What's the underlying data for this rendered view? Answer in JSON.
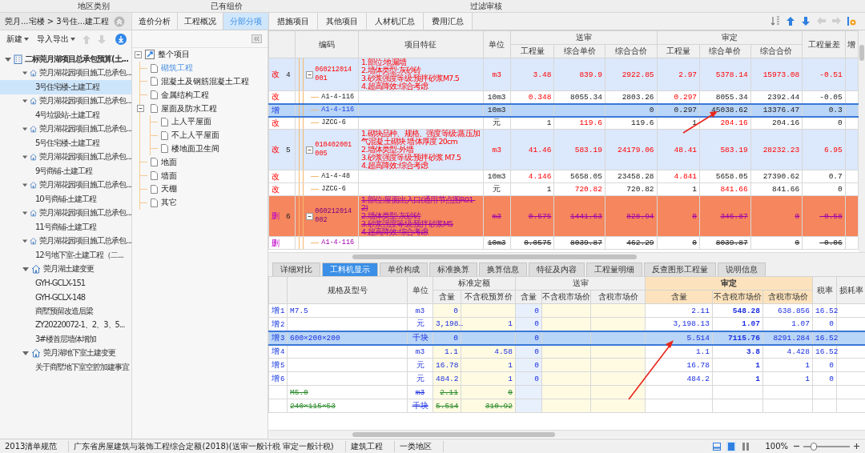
{
  "toolbar": {
    "labels": [
      "地区类别",
      "已有组价",
      "过滤审核"
    ]
  },
  "project_panel": {
    "breadcrumb": "莞月...宅楼 > 3号住...建工程",
    "buttons": [
      {
        "label": "新建",
        "kind": "dropdown"
      },
      {
        "label": "导入导出",
        "kind": "dropdown"
      }
    ],
    "move_buttons": [
      {
        "kind": "up",
        "disabled": true
      },
      {
        "kind": "down",
        "disabled": true
      }
    ],
    "tree": [
      {
        "label": "二标莞月湖项目总承包预算(土...",
        "kind": "project",
        "expanded": true,
        "selected": false,
        "children": [
          {
            "label": "莞月湖花园项目施工总承包...",
            "kind": "group",
            "expanded": true,
            "selected": false,
            "children": [
              {
                "label": "3号住宅楼-土建工程",
                "selected": true
              }
            ]
          },
          {
            "label": "莞月湖花园项目施工总承包...",
            "kind": "group",
            "expanded": true,
            "selected": false,
            "children": [
              {
                "label": "4号垃圾站-土建工程",
                "selected": false
              }
            ]
          },
          {
            "label": "莞月湖花园项目施工总承包...",
            "kind": "group",
            "expanded": true,
            "selected": false,
            "children": [
              {
                "label": "5号住宅楼-土建工程",
                "selected": false
              }
            ]
          },
          {
            "label": "莞月湖花园项目施工总承包...",
            "kind": "group",
            "expanded": true,
            "selected": false,
            "children": [
              {
                "label": "9号商铺-土建工程",
                "selected": false
              }
            ]
          },
          {
            "label": "莞月湖花园项目施工总承包...",
            "kind": "group",
            "expanded": true,
            "selected": false,
            "children": [
              {
                "label": "10号商铺-土建工程",
                "selected": false
              }
            ]
          },
          {
            "label": "莞月湖花园项目施工总承包...",
            "kind": "group",
            "expanded": true,
            "selected": false,
            "children": [
              {
                "label": "11号商铺-土建工程",
                "selected": false
              }
            ]
          },
          {
            "label": "莞月湖花园项目施工总承包...",
            "kind": "group",
            "expanded": true,
            "selected": false,
            "children": [
              {
                "label": "12号地下室-土建工程（二...",
                "selected": false
              }
            ]
          },
          {
            "label": "莞月湖土建变更",
            "kind": "group",
            "expanded": true,
            "selected": false,
            "children": [
              {
                "label": "GYH-GCLX-151",
                "selected": false
              },
              {
                "label": "GYH-GCLX-148",
                "selected": false
              },
              {
                "label": "商墅预留改造后梁",
                "selected": false
              },
              {
                "label": "ZY20220072-1、2、3、5...",
                "selected": false
              },
              {
                "label": "3#楼首层墙体增加",
                "selected": false
              }
            ]
          },
          {
            "label": "莞月湖地下室土建变更",
            "kind": "group",
            "expanded": true,
            "selected": false,
            "children": [
              {
                "label": "关于商墅地下室空腔加建事宜",
                "selected": false
              }
            ]
          }
        ]
      }
    ]
  },
  "view_tabs": [
    {
      "label": "造价分析",
      "selected": false
    },
    {
      "label": "工程概况",
      "selected": false
    },
    {
      "label": "分部分项",
      "selected": true
    },
    {
      "label": "措施项目",
      "selected": false
    },
    {
      "label": "其他项目",
      "selected": false
    },
    {
      "label": "人材机汇总",
      "selected": false
    },
    {
      "label": "费用汇总",
      "selected": false
    }
  ],
  "toolbar_icons": [
    {
      "kind": "sort",
      "disabled": false
    },
    {
      "kind": "up",
      "disabled": false
    },
    {
      "kind": "down",
      "disabled": false
    },
    {
      "kind": "left",
      "disabled": true
    },
    {
      "kind": "right",
      "disabled": true
    },
    {
      "kind": "settings",
      "disabled": false
    }
  ],
  "section_tree": [
    {
      "label": "整个项目",
      "kind": "root",
      "expanded": true,
      "selected": false,
      "children": [
        {
          "label": "砌筑工程",
          "selected": true
        },
        {
          "label": "混凝土及钢筋混凝土工程",
          "selected": false
        },
        {
          "label": "金属结构工程",
          "selected": false
        },
        {
          "label": "屋面及防水工程",
          "selected": false,
          "expanded": true,
          "children": [
            {
              "label": "上人平屋面",
              "selected": false
            },
            {
              "label": "不上人平屋面",
              "selected": false
            },
            {
              "label": "楼地面卫生间",
              "selected": false
            }
          ]
        },
        {
          "label": "地面",
          "selected": false
        },
        {
          "label": "墙面",
          "selected": false
        },
        {
          "label": "天棚",
          "selected": false
        },
        {
          "label": "其它",
          "selected": false
        }
      ]
    }
  ],
  "bill_table": {
    "columns": [
      "编码",
      "项目特征",
      "单位"
    ],
    "groups": [
      {
        "label": "送审",
        "highlighted": false,
        "columns": [
          "工程量",
          "综合单价",
          "综合合价"
        ]
      },
      {
        "label": "审定",
        "highlighted": false,
        "columns": [
          "工程量",
          "综合单价",
          "综合合价"
        ]
      }
    ],
    "trailing_columns": [
      "工程量差",
      "增"
    ],
    "rows": [
      {
        "kind": "changed",
        "expanded": true,
        "flag": "改",
        "index": "4",
        "code": "060212014001",
        "features": [
          "1.部位:地漏墙",
          "2.墙体类型:灰砂砖",
          "3.砂浆强度等级:预拌砂浆M7.5",
          "4.超高降效:综合考虑"
        ],
        "unit": "m3",
        "selected": false,
        "cells": {
          "submit_qty": {
            "text": "3.48",
            "changed": true
          },
          "submit_price": {
            "text": "839.9",
            "changed": true
          },
          "submit_total": {
            "text": "2922.85",
            "changed": true
          },
          "approved_qty": {
            "text": "2.97",
            "changed": true
          },
          "approved_price": {
            "text": "5378.14",
            "changed": true
          },
          "approved_total": {
            "text": "15973.08",
            "changed": true
          },
          "qty_diff": {
            "text": "-0.51",
            "changed": true
          }
        }
      },
      {
        "kind": "changed",
        "flag": "改",
        "code": "A1-4-116",
        "unit": "10m3",
        "selected": false,
        "cells": {
          "submit_qty": {
            "text": "0.348",
            "changed": true
          },
          "submit_price": {
            "text": "8055.34",
            "changed": false
          },
          "submit_total": {
            "text": "2803.26",
            "changed": false
          },
          "approved_qty": {
            "text": "0.297",
            "changed": true
          },
          "approved_price": {
            "text": "8055.34",
            "changed": false
          },
          "approved_total": {
            "text": "2392.44",
            "changed": false
          },
          "qty_diff": {
            "text": "-0.05",
            "changed": false
          }
        }
      },
      {
        "kind": "added",
        "flag": "增",
        "code": "A1-4-116",
        "unit": "10m3",
        "selected": true,
        "cells": {
          "submit_total": {
            "text": "0",
            "changed": false
          },
          "approved_qty": {
            "text": "0.297",
            "changed": false
          },
          "approved_price": {
            "text": "45038.62",
            "changed": false
          },
          "approved_total": {
            "text": "13376.47",
            "changed": false
          },
          "qty_diff": {
            "text": "0.3",
            "changed": false
          }
        }
      },
      {
        "kind": "changed",
        "flag": "改",
        "code": "JZCG-6",
        "unit": "元",
        "selected": false,
        "cells": {
          "submit_qty": {
            "text": "1",
            "changed": false
          },
          "submit_price": {
            "text": "119.6",
            "changed": true
          },
          "submit_total": {
            "text": "119.6",
            "changed": false
          },
          "approved_qty": {
            "text": "1",
            "changed": false
          },
          "approved_price": {
            "text": "204.16",
            "changed": true
          },
          "approved_total": {
            "text": "204.16",
            "changed": false
          },
          "qty_diff": {
            "text": "0",
            "changed": false
          }
        }
      },
      {
        "kind": "changed",
        "expanded": true,
        "flag": "改",
        "index": "5",
        "code": "010402001005",
        "features": [
          "1.砌块品种、规格、强度等级:蒸压加气混凝土砌块 墙体厚度 20cm",
          "2.墙体类型:外墙",
          "3.砂浆强度等级:预拌砂浆 M7.5",
          "4.超高降效:综合考虑"
        ],
        "unit": "m3",
        "selected": false,
        "cells": {
          "submit_qty": {
            "text": "41.46",
            "changed": true
          },
          "submit_price": {
            "text": "583.19",
            "changed": true
          },
          "submit_total": {
            "text": "24179.06",
            "changed": true
          },
          "approved_qty": {
            "text": "48.41",
            "changed": true
          },
          "approved_price": {
            "text": "583.19",
            "changed": true
          },
          "approved_total": {
            "text": "28232.23",
            "changed": true
          },
          "qty_diff": {
            "text": "6.95",
            "changed": true
          }
        }
      },
      {
        "kind": "changed",
        "flag": "改",
        "code": "A1-4-48",
        "unit": "10m3",
        "selected": false,
        "cells": {
          "submit_qty": {
            "text": "4.146",
            "changed": true
          },
          "submit_price": {
            "text": "5658.05",
            "changed": false
          },
          "submit_total": {
            "text": "23458.28",
            "changed": false
          },
          "approved_qty": {
            "text": "4.841",
            "changed": true
          },
          "approved_price": {
            "text": "5658.05",
            "changed": false
          },
          "approved_total": {
            "text": "27390.62",
            "changed": false
          },
          "qty_diff": {
            "text": "0.7",
            "changed": false
          }
        }
      },
      {
        "kind": "changed",
        "flag": "改",
        "code": "JZCG-6",
        "unit": "元",
        "selected": false,
        "cells": {
          "submit_qty": {
            "text": "1",
            "changed": false
          },
          "submit_price": {
            "text": "720.82",
            "changed": true
          },
          "submit_total": {
            "text": "720.82",
            "changed": false
          },
          "approved_qty": {
            "text": "1",
            "changed": false
          },
          "approved_price": {
            "text": "841.66",
            "changed": true
          },
          "approved_total": {
            "text": "841.66",
            "changed": false
          },
          "qty_diff": {
            "text": "0",
            "changed": false
          }
        }
      },
      {
        "kind": "deleted",
        "expanded": true,
        "flag": "删",
        "index": "6",
        "code": "060212014002",
        "features": [
          "1.部位:屋面出入口(通用节点图R01-2)",
          "2.墙体类型:灰砂砖",
          "3.砂浆强度等级:预拌砂浆M5",
          "4.超高降效:综合考虑"
        ],
        "unit": "m3",
        "selected": false,
        "cells": {
          "submit_qty": {
            "text": "0.575",
            "changed": false
          },
          "submit_price": {
            "text": "1441.63",
            "changed": false
          },
          "submit_total": {
            "text": "828.94",
            "changed": false
          },
          "approved_qty": {
            "text": "0",
            "changed": false
          },
          "approved_price": {
            "text": "346.87",
            "changed": false
          },
          "approved_total": {
            "text": "0",
            "changed": false
          },
          "qty_diff": {
            "text": "-0.58",
            "changed": false
          }
        }
      },
      {
        "kind": "deleted",
        "flag": "删",
        "code": "A1-4-116",
        "unit": "10m3",
        "selected": false,
        "cells": {
          "submit_qty": {
            "text": "0.0575",
            "changed": false
          },
          "submit_price": {
            "text": "8039.87",
            "changed": false
          },
          "submit_total": {
            "text": "462.29",
            "changed": false
          },
          "approved_qty": {
            "text": "0",
            "changed": false
          },
          "approved_price": {
            "text": "8039.87",
            "changed": false
          },
          "approved_total": {
            "text": "0",
            "changed": false
          },
          "qty_diff": {
            "text": "-0.06",
            "changed": false
          }
        }
      }
    ]
  },
  "detail_tabs": [
    {
      "label": "详细对比",
      "selected": false
    },
    {
      "label": "工料机显示",
      "selected": true
    },
    {
      "label": "单价构成",
      "selected": false
    },
    {
      "label": "标准换算",
      "selected": false
    },
    {
      "label": "换算信息",
      "selected": false
    },
    {
      "label": "特征及内容",
      "selected": false
    },
    {
      "label": "工程量明细",
      "selected": false
    },
    {
      "label": "反查图形工程量",
      "selected": false
    },
    {
      "label": "说明信息",
      "selected": false
    }
  ],
  "resource_table": {
    "columns": [
      "规格及型号",
      "单位"
    ],
    "groups": [
      {
        "label": "标准定额",
        "highlighted": false,
        "columns": [
          "含量",
          "不含税预算价"
        ]
      },
      {
        "label": "送审",
        "highlighted": false,
        "columns": [
          "含量",
          "不含税市场价",
          "含税市场价"
        ]
      },
      {
        "label": "审定",
        "highlighted": true,
        "columns": [
          "含量",
          "不含税市场价",
          "含税市场价"
        ]
      }
    ],
    "trailing_columns": [
      "税率",
      "损耗率"
    ],
    "rows": [
      {
        "kind": "added",
        "flag": "增",
        "index": "1",
        "spec": "M7.5",
        "unit": "m3",
        "selected": false,
        "cells": {
          "std_content": "0",
          "submit_content": "0",
          "approved_content": "2.11",
          "approved_price": "548.28",
          "approved_price_tax": "638.856",
          "tax_rate": "16.52"
        }
      },
      {
        "kind": "added",
        "flag": "增",
        "index": "2",
        "unit": "元",
        "selected": false,
        "cells": {
          "std_content": "3,198…",
          "std_price": "1",
          "submit_content": "0",
          "approved_content": "3,198.13",
          "approved_price": "1.07",
          "approved_price_tax": "1.07",
          "tax_rate": "0"
        }
      },
      {
        "kind": "added",
        "flag": "增",
        "index": "3",
        "spec": "600×200×200",
        "unit": "千块",
        "selected": true,
        "cells": {
          "std_content": "0",
          "submit_content": "0",
          "approved_content": "5.514",
          "approved_price": "7115.76",
          "approved_price_tax": "8291.284",
          "tax_rate": "16.52"
        }
      },
      {
        "kind": "added",
        "flag": "增",
        "index": "4",
        "unit": "m3",
        "selected": false,
        "cells": {
          "std_content": "1.1",
          "std_price": "4.58",
          "submit_content": "0",
          "approved_content": "1.1",
          "approved_price": "3.8",
          "approved_price_tax": "4.428",
          "tax_rate": "16.52"
        }
      },
      {
        "kind": "added",
        "flag": "增",
        "index": "5",
        "unit": "元",
        "selected": false,
        "cells": {
          "std_content": "16.78",
          "std_price": "1",
          "submit_content": "0",
          "approved_content": "16.78",
          "approved_price": "1",
          "approved_price_tax": "1",
          "tax_rate": "0"
        }
      },
      {
        "kind": "added",
        "flag": "增",
        "index": "6",
        "unit": "元",
        "selected": false,
        "cells": {
          "std_content": "484.2",
          "std_price": "1",
          "submit_content": "0",
          "approved_content": "484.2",
          "approved_price": "1",
          "approved_price_tax": "1",
          "tax_rate": "0"
        }
      },
      {
        "kind": "deleted",
        "spec": "M5.0",
        "unit": "m3",
        "selected": false,
        "cells": {
          "std_content": "2.11",
          "std_price": "0"
        }
      },
      {
        "kind": "deleted",
        "spec": "240×115×53",
        "unit": "千块",
        "selected": false,
        "cells": {
          "std_content": "5.514",
          "std_price": "310.92"
        }
      }
    ]
  },
  "status_bar": {
    "texts": [
      "2013清单规范",
      "广东省房屋建筑与装饰工程综合定额(2018)(送审一般计税 审定一般计税)",
      "建筑工程",
      "一类地区"
    ],
    "view_buttons": [
      {
        "kind": "sheet",
        "selected": false
      },
      {
        "kind": "page",
        "selected": true
      },
      {
        "kind": "split",
        "selected": false
      }
    ],
    "zoom": "100%",
    "zoom_slider": {
      "level": 0.22
    }
  }
}
